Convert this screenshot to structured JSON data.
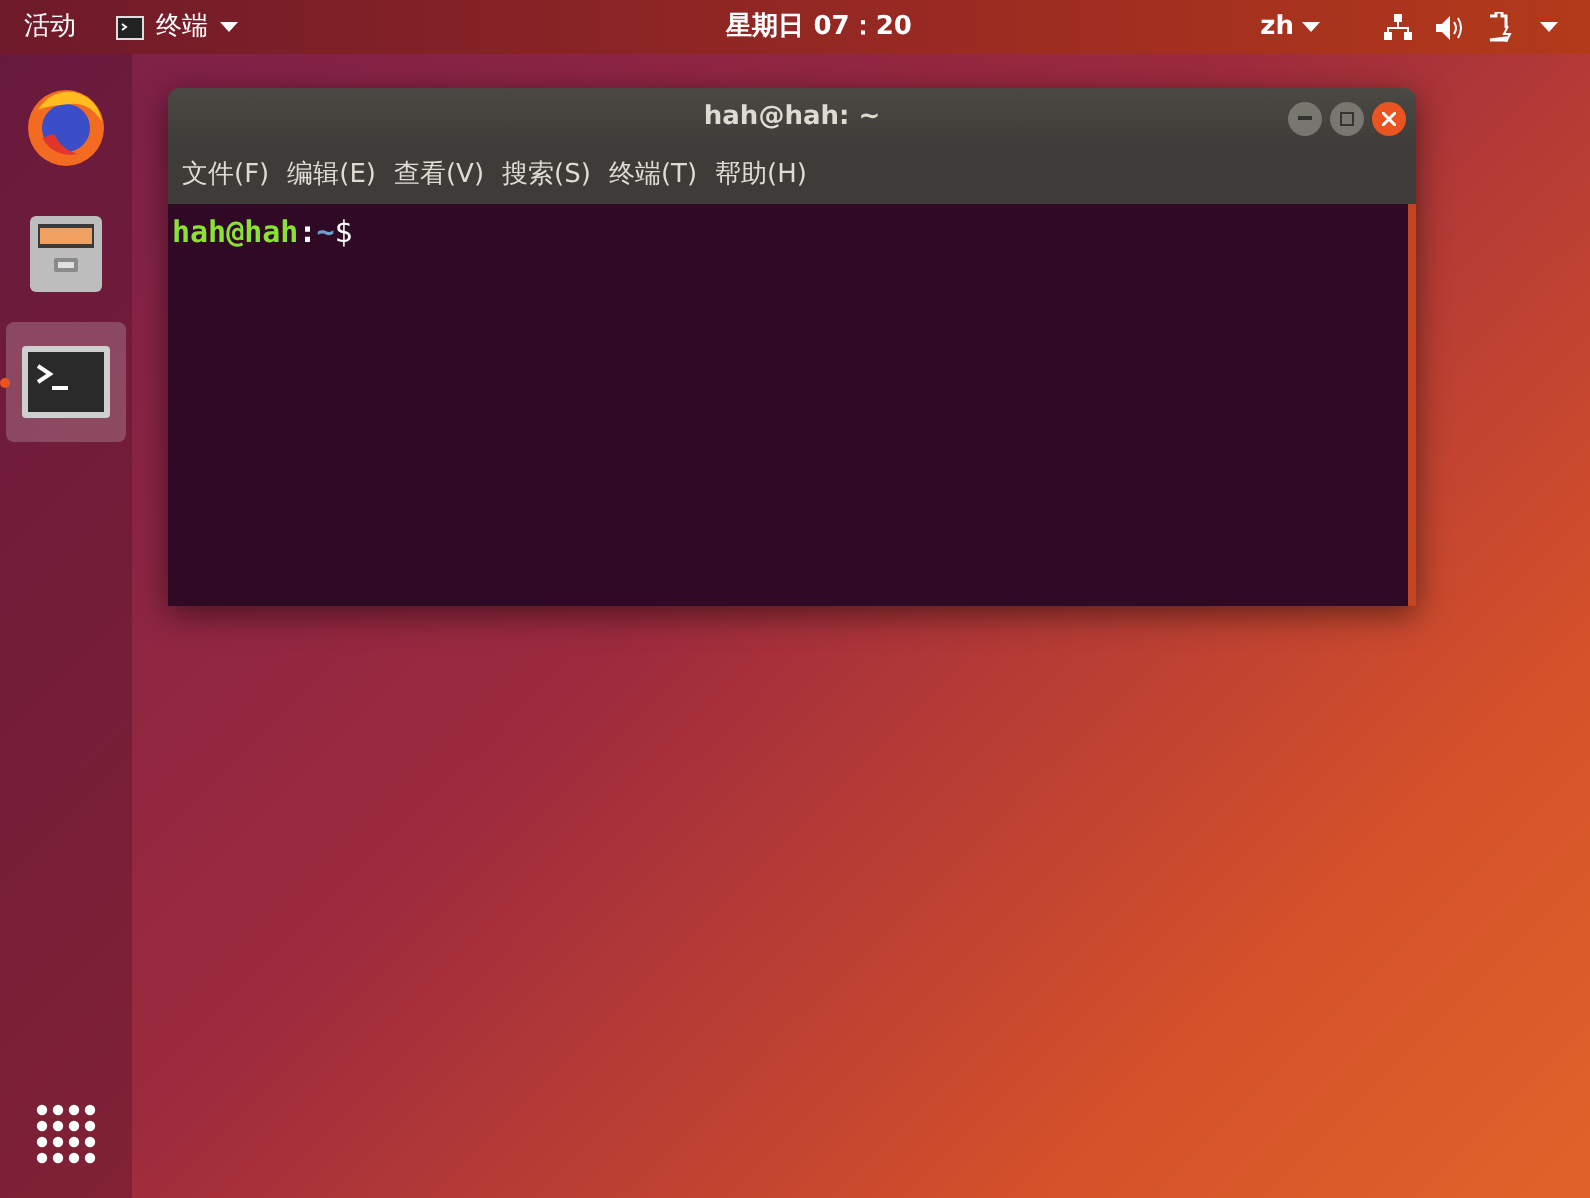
{
  "top_bar": {
    "activities": "活动",
    "app_menu": "终端",
    "clock": "星期日 07：20",
    "input_method": "zh"
  },
  "dock": {
    "items": [
      {
        "kind": "browser",
        "selected": false,
        "running": false
      },
      {
        "kind": "files",
        "selected": false,
        "running": false
      },
      {
        "kind": "terminal",
        "selected": true,
        "running": true
      }
    ]
  },
  "window": {
    "title": "hah@hah: ~",
    "menu": [
      "文件(F)",
      "编辑(E)",
      "查看(V)",
      "搜索(S)",
      "终端(T)",
      "帮助(H)"
    ],
    "prompt": [
      {
        "kind": "user",
        "text": "hah@hah"
      },
      {
        "kind": "sep",
        "text": ":"
      },
      {
        "kind": "path",
        "text": "~"
      },
      {
        "kind": "sign",
        "text": "$"
      }
    ]
  }
}
